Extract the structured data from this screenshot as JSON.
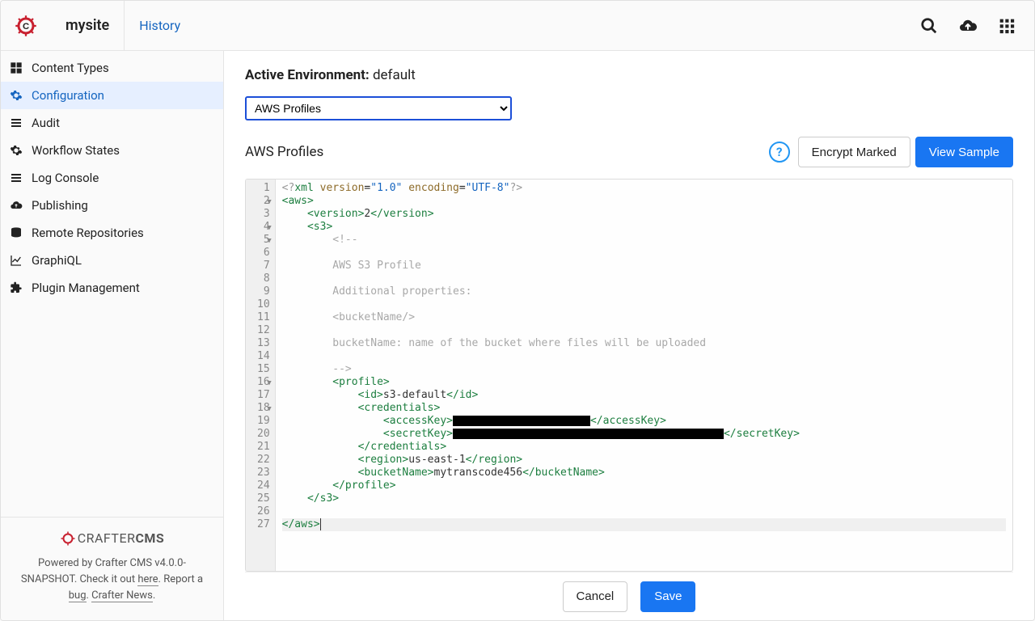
{
  "header": {
    "site_name": "mysite",
    "history_label": "History"
  },
  "sidebar": {
    "items": [
      {
        "label": "Content Types",
        "icon": "grid-icon"
      },
      {
        "label": "Configuration",
        "icon": "gear-icon"
      },
      {
        "label": "Audit",
        "icon": "list-icon"
      },
      {
        "label": "Workflow States",
        "icon": "gear-icon"
      },
      {
        "label": "Log Console",
        "icon": "list-icon"
      },
      {
        "label": "Publishing",
        "icon": "cloud-up-icon"
      },
      {
        "label": "Remote Repositories",
        "icon": "database-icon"
      },
      {
        "label": "GraphiQL",
        "icon": "chart-line-icon"
      },
      {
        "label": "Plugin Management",
        "icon": "puzzle-icon"
      }
    ],
    "active_index": 1,
    "footer": {
      "logo_text_1": "CRAFTER",
      "logo_text_2": "CMS",
      "line1_a": "Powered by Crafter CMS v4.0.0-",
      "line1_b": "SNAPSHOT. Check it out ",
      "here": "here",
      "line2_a": ". Report a ",
      "bug": "bug",
      "line2_b": ". ",
      "news": "Crafter News",
      "line2_c": "."
    }
  },
  "main": {
    "env_label": "Active Environment:",
    "env_value": "default",
    "select_options": [
      "AWS Profiles"
    ],
    "select_value": "AWS Profiles",
    "section_title": "AWS Profiles",
    "encrypt_label": "Encrypt Marked",
    "view_sample_label": "View Sample"
  },
  "editor": {
    "line_count": 27,
    "fold_lines": [
      2,
      4,
      5,
      16,
      18
    ],
    "highlighted_line": 27,
    "content": {
      "xml_version": "1.0",
      "xml_encoding": "UTF-8",
      "version": "2",
      "comment_title": "AWS S3 Profile",
      "comment_props": "Additional properties:",
      "comment_bucket_tag": "<bucketName/>",
      "comment_bucket_desc": "bucketName: name of the bucket where files will be uploaded",
      "profile_id": "s3-default",
      "region": "us-east-1",
      "bucket_name": "mytranscode456"
    }
  },
  "bottom": {
    "cancel_label": "Cancel",
    "save_label": "Save"
  }
}
